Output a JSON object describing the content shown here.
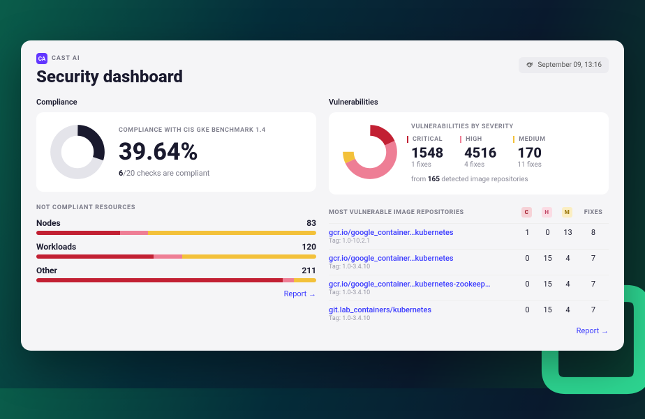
{
  "brand": {
    "badge": "CA",
    "text": "CAST AI"
  },
  "page_title": "Security dashboard",
  "refresh_label": "September 09, 13:16",
  "compliance": {
    "section": "Compliance",
    "subtitle": "COMPLIANCE WITH CIS GKE BENCHMARK 1.4",
    "percent": "39.64%",
    "checks_done": "6",
    "checks_total": "/20",
    "checks_text": " checks are compliant",
    "non_compliant_label": "NOT COMPLIANT RESOURCES",
    "resources": [
      {
        "name": "Nodes",
        "count": "83",
        "segments": [
          30,
          10,
          60
        ]
      },
      {
        "name": "Workloads",
        "count": "120",
        "segments": [
          42,
          10,
          48
        ]
      },
      {
        "name": "Other",
        "count": "211",
        "segments": [
          88,
          4,
          8
        ]
      }
    ],
    "report_link": "Report"
  },
  "vulnerabilities": {
    "section": "Vulnerabilities",
    "subtitle": "VULNERABILITIES BY SEVERITY",
    "stats": [
      {
        "label": "CRITICAL",
        "value": "1548",
        "fixes": "1 fixes",
        "class": "sev-critical"
      },
      {
        "label": "HIGH",
        "value": "4516",
        "fixes": "4 fixes",
        "class": "sev-high"
      },
      {
        "label": "MEDIUM",
        "value": "170",
        "fixes": "11 fixes",
        "class": "sev-medium"
      }
    ],
    "footer_prefix": "from ",
    "footer_count": "165",
    "footer_suffix": " detected image repositories",
    "repos_label": "MOST VULNERABLE IMAGE REPOSITORIES",
    "chips": {
      "c": "C",
      "h": "H",
      "m": "M"
    },
    "fixes_col": "FIXES",
    "repos": [
      {
        "name": "gcr.io/google_container…kubernetes",
        "tag": "Tag: 1.0-10.2.1",
        "c": "1",
        "h": "0",
        "m": "13",
        "fixes": "8"
      },
      {
        "name": "gcr.io/google_container…kubernetes",
        "tag": "Tag: 1.0-3.4.10",
        "c": "0",
        "h": "15",
        "m": "4",
        "fixes": "7"
      },
      {
        "name": "gcr.io/google_container…kubernetes-zookeep…",
        "tag": "Tag: 1.0-3.4.10",
        "c": "0",
        "h": "15",
        "m": "4",
        "fixes": "7"
      },
      {
        "name": "git.lab_containers/kubernetes",
        "tag": "Tag: 1.0-3.4.10",
        "c": "0",
        "h": "15",
        "m": "4",
        "fixes": "7"
      }
    ],
    "report_link": "Report"
  }
}
